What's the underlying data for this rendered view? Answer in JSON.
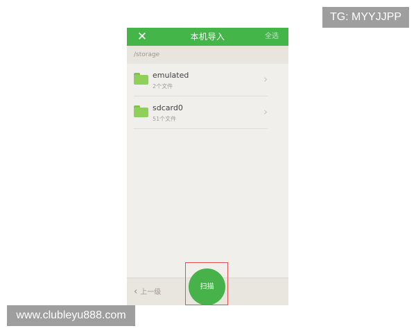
{
  "watermarks": {
    "top_right": "TG: MYYJJPP",
    "bottom_left": "www.clubleyu888.com"
  },
  "header": {
    "close_icon": "close-icon",
    "title": "本机导入",
    "select_all": "全选"
  },
  "path": "/storage",
  "folders": [
    {
      "name": "emulated",
      "count": "2个文件",
      "icon": "folder-icon"
    },
    {
      "name": "sdcard0",
      "count": "51个文件",
      "icon": "folder-icon"
    }
  ],
  "footer": {
    "up_label": "上一级",
    "scan_label": "扫描"
  },
  "colors": {
    "accent": "#44b549",
    "highlight": "#e25050"
  }
}
